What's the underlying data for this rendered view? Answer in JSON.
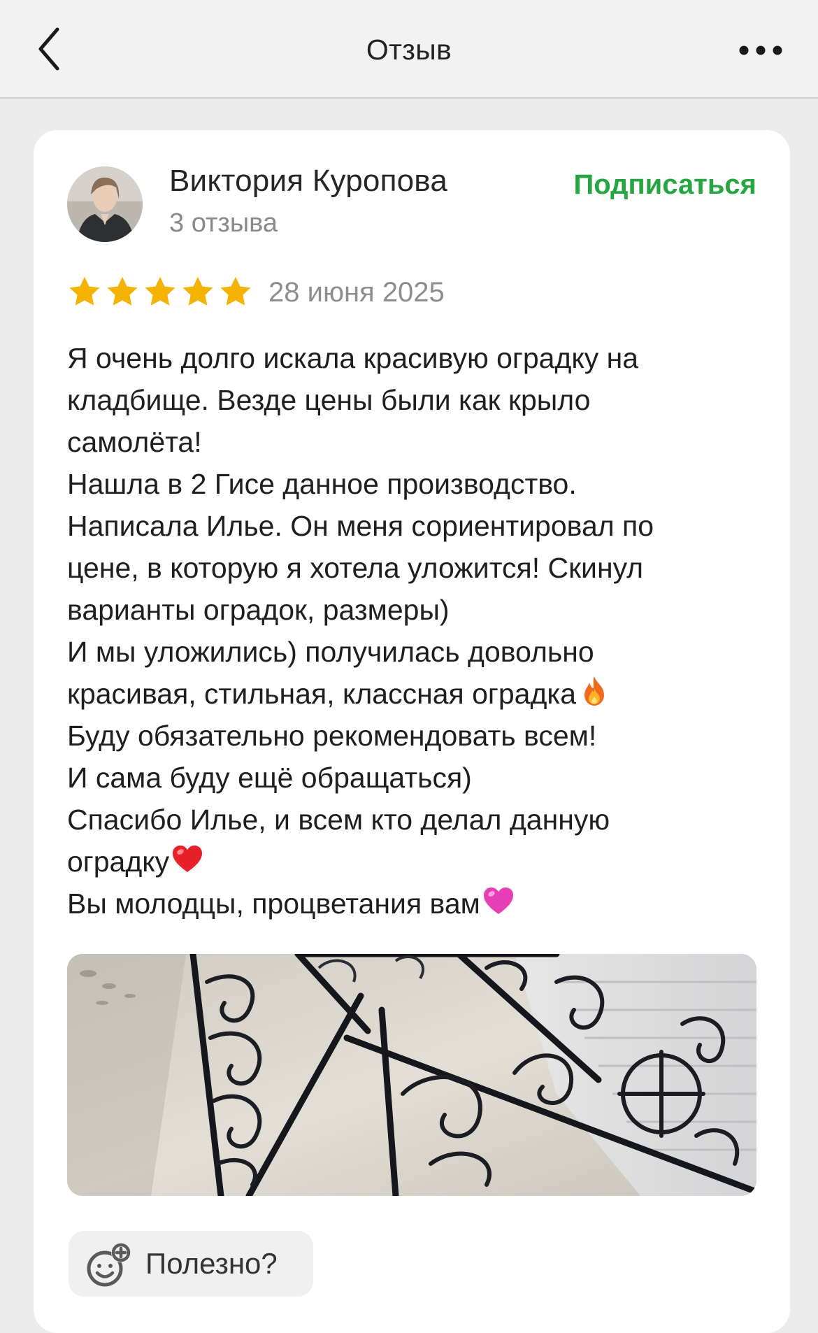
{
  "header": {
    "title": "Отзыв",
    "back_icon": "chevron-left-icon",
    "more_icon": "more-horizontal-icon"
  },
  "author": {
    "name": "Виктория Куропова",
    "reviews_count": "3 отзыва",
    "subscribe_label": "Подписаться"
  },
  "rating": {
    "stars": 5,
    "max_stars": 5,
    "date": "28 июня 2025"
  },
  "review": {
    "lines": [
      "Я очень долго искала красивую оградку на",
      "кладбище. Везде цены были как крыло",
      "самолёта!",
      "Нашла в 2 Гисе данное производство.",
      "Написала Илье. Он меня сориентировал по",
      "цене, в которую я хотела уложится! Скинул",
      "варианты оградок, размеры)",
      "И мы уложились) получилась довольно",
      "красивая, стильная, классная оградка",
      "Буду обязательно рекомендовать всем!",
      "И сама буду ещё обращаться)",
      "Спасибо Илье, и всем кто делал данную",
      "оградку",
      "Вы молодцы, процветания вам"
    ],
    "emojis": [
      "fire-emoji",
      "red-heart-emoji",
      "pink-heart-emoji"
    ]
  },
  "photo": {
    "description_icon": "review-photo"
  },
  "helpful": {
    "label": "Полезно?",
    "icon": "smile-plus-icon"
  },
  "colors": {
    "accent_green": "#26a641",
    "star_gold": "#f5b301",
    "background": "#ececec",
    "card": "#ffffff"
  }
}
